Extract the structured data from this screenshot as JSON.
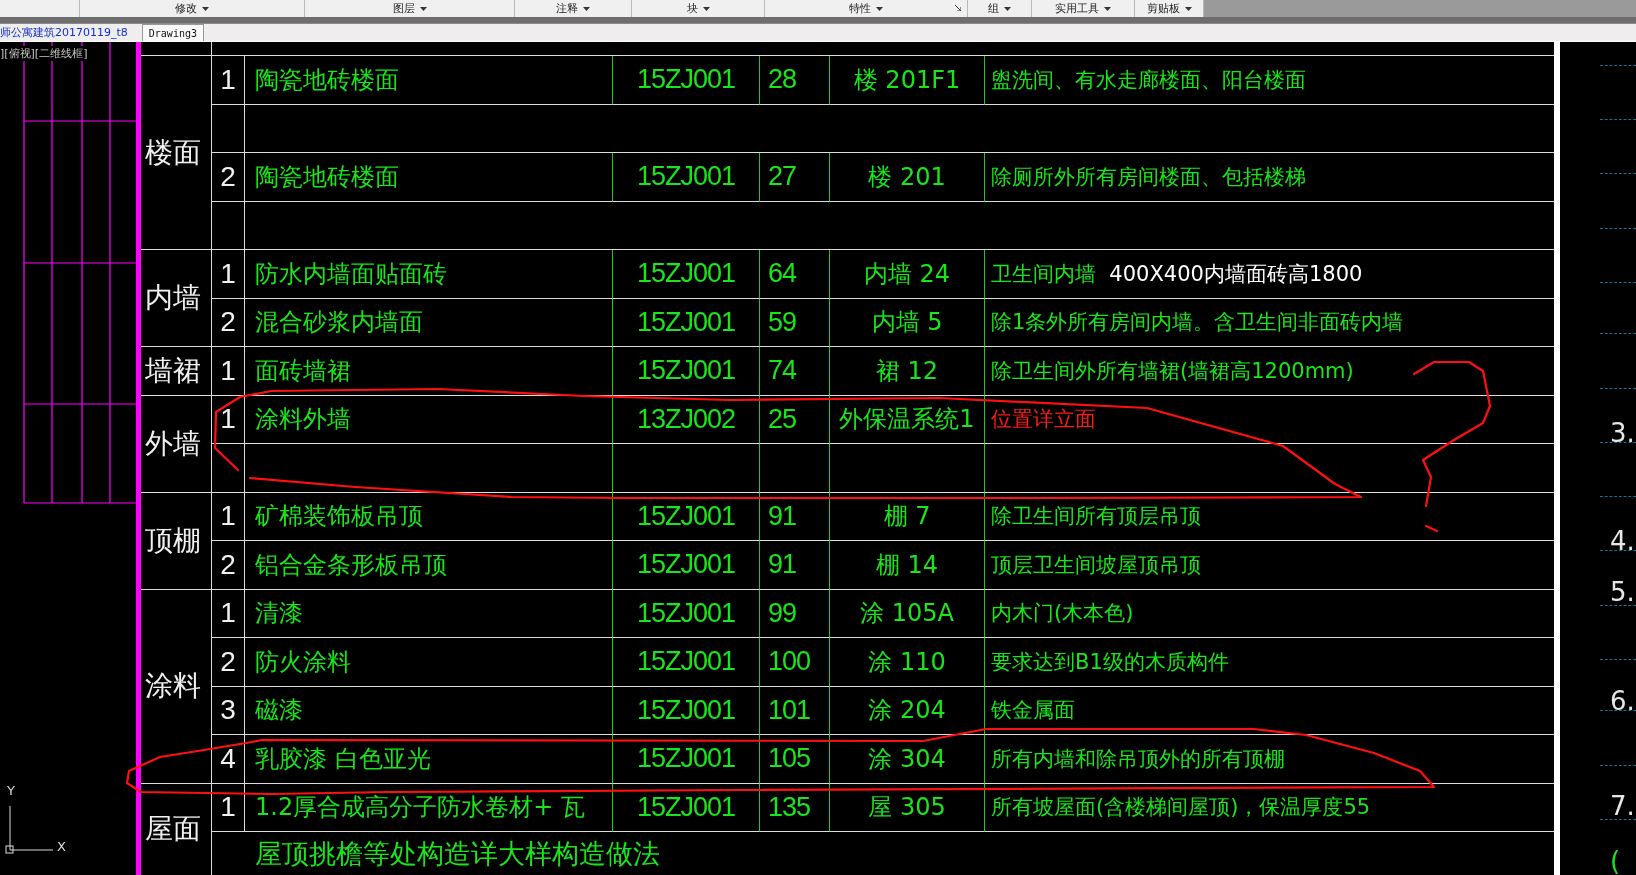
{
  "ribbon": {
    "panels": [
      {
        "label": "修改",
        "launcher": false
      },
      {
        "label": "图层",
        "launcher": false
      },
      {
        "label": "注释",
        "launcher": false
      },
      {
        "label": "块",
        "launcher": false
      },
      {
        "label": "特性",
        "launcher": true
      },
      {
        "label": "组",
        "launcher": false
      },
      {
        "label": "实用工具",
        "launcher": false
      },
      {
        "label": "剪贴板",
        "launcher": false
      }
    ]
  },
  "file_tabs": [
    {
      "label": "师公寓建筑20170119_t8",
      "selected": false
    },
    {
      "label": "Drawing3",
      "selected": true
    }
  ],
  "viewport": {
    "view_label": "][俯视][二维线框]",
    "axis_x": "X",
    "axis_y": "Y"
  },
  "table": {
    "categories": [
      {
        "label": "楼面",
        "rows": [
          {
            "kind": "item",
            "no": "1",
            "name": "陶瓷地砖楼面",
            "code": "15ZJ001",
            "page": "28",
            "ref": "楼 201F1",
            "desc": [
              {
                "text": "盥洗间、有水走廊楼面、阳台楼面",
                "color": "#19e619"
              }
            ]
          },
          {
            "kind": "blank"
          },
          {
            "kind": "item",
            "no": "2",
            "name": "陶瓷地砖楼面",
            "code": "15ZJ001",
            "page": "27",
            "ref": "楼 201",
            "desc": [
              {
                "text": "除厕所外所有房间楼面、包括楼梯",
                "color": "#19e619"
              }
            ]
          },
          {
            "kind": "blank"
          }
        ]
      },
      {
        "label": "内墙",
        "rows": [
          {
            "kind": "item",
            "no": "1",
            "name": "防水内墙面贴面砖",
            "code": "15ZJ001",
            "page": "64",
            "ref": "内墙 24",
            "desc": [
              {
                "text": "卫生间内墙  ",
                "color": "#19e619"
              },
              {
                "text": "400X400内墙面砖高1800",
                "color": "#ffffff"
              }
            ]
          },
          {
            "kind": "item",
            "no": "2",
            "name": "混合砂浆内墙面",
            "code": "15ZJ001",
            "page": "59",
            "ref": "内墙 5",
            "desc": [
              {
                "text": "除1条外所有房间内墙。含卫生间非面砖内墙",
                "color": "#19e619"
              }
            ]
          }
        ]
      },
      {
        "label": "墙裙",
        "rows": [
          {
            "kind": "item",
            "no": "1",
            "name": "面砖墙裙",
            "code": "15ZJ001",
            "page": "74",
            "ref": "裙  12",
            "desc": [
              {
                "text": "除卫生间外所有墙裙(墙裙高1200mm)",
                "color": "#19e619"
              }
            ]
          }
        ]
      },
      {
        "label": "外墙",
        "rows": [
          {
            "kind": "item",
            "no": "1",
            "name": "涂料外墙",
            "code": "13ZJ002",
            "page": "25",
            "ref": "外保温系统1",
            "desc": [
              {
                "text": "位置详立面",
                "color": "#ff1a1a"
              }
            ]
          },
          {
            "kind": "ruled_blank"
          }
        ]
      },
      {
        "label": "顶棚",
        "rows": [
          {
            "kind": "item",
            "no": "1",
            "name": "矿棉装饰板吊顶",
            "code": "15ZJ001",
            "page": "91",
            "ref": "棚  7",
            "desc": [
              {
                "text": "除卫生间所有顶层吊顶",
                "color": "#19e619"
              }
            ]
          },
          {
            "kind": "item",
            "no": "2",
            "name": "铝合金条形板吊顶",
            "code": "15ZJ001",
            "page": "91",
            "ref": "棚  14",
            "desc": [
              {
                "text": "顶层卫生间坡屋顶吊顶",
                "color": "#19e619"
              }
            ]
          }
        ]
      },
      {
        "label": "涂料",
        "rows": [
          {
            "kind": "item",
            "no": "1",
            "name": "清漆",
            "code": "15ZJ001",
            "page": "99",
            "ref": "涂  105A",
            "desc": [
              {
                "text": "内木门(木本色)",
                "color": "#19e619"
              }
            ]
          },
          {
            "kind": "item",
            "no": "2",
            "name": "防火涂料",
            "code": "15ZJ001",
            "page": "100",
            "ref": "涂  110",
            "desc": [
              {
                "text": "要求达到B1级的木质构件",
                "color": "#19e619"
              }
            ]
          },
          {
            "kind": "item",
            "no": "3",
            "name": "磁漆",
            "code": "15ZJ001",
            "page": "101",
            "ref": "涂  204",
            "desc": [
              {
                "text": "铁金属面",
                "color": "#19e619"
              }
            ]
          },
          {
            "kind": "item",
            "no": "4",
            "name": "乳胶漆 白色亚光",
            "code": "15ZJ001",
            "page": "105",
            "ref": "涂  304",
            "desc": [
              {
                "text": "所有内墙和除吊顶外的所有顶棚",
                "color": "#19e619"
              }
            ]
          }
        ]
      },
      {
        "label": "屋面",
        "rows": [
          {
            "kind": "item",
            "no": "1",
            "name": "1.2厚合成高分子防水卷材+ 瓦",
            "code": "15ZJ001",
            "page": "135",
            "ref": "屋  305",
            "desc": [
              {
                "text": "所有坡屋面(含楼梯间屋顶)，保温厚度55",
                "color": "#19e619"
              }
            ]
          },
          {
            "kind": "note",
            "text": "屋顶挑檐等处构造详大样构造做法"
          }
        ]
      }
    ]
  },
  "side_notes": [
    {
      "text": "3.",
      "color": "#e6e6e6"
    },
    {
      "text": "4.",
      "color": "#e6e6e6"
    },
    {
      "text": "5.",
      "color": "#e6e6e6"
    },
    {
      "text": "6.",
      "color": "#e6e6e6"
    },
    {
      "text": "7.",
      "color": "#e6e6e6"
    },
    {
      "text": "(",
      "color": "#19e619"
    }
  ]
}
